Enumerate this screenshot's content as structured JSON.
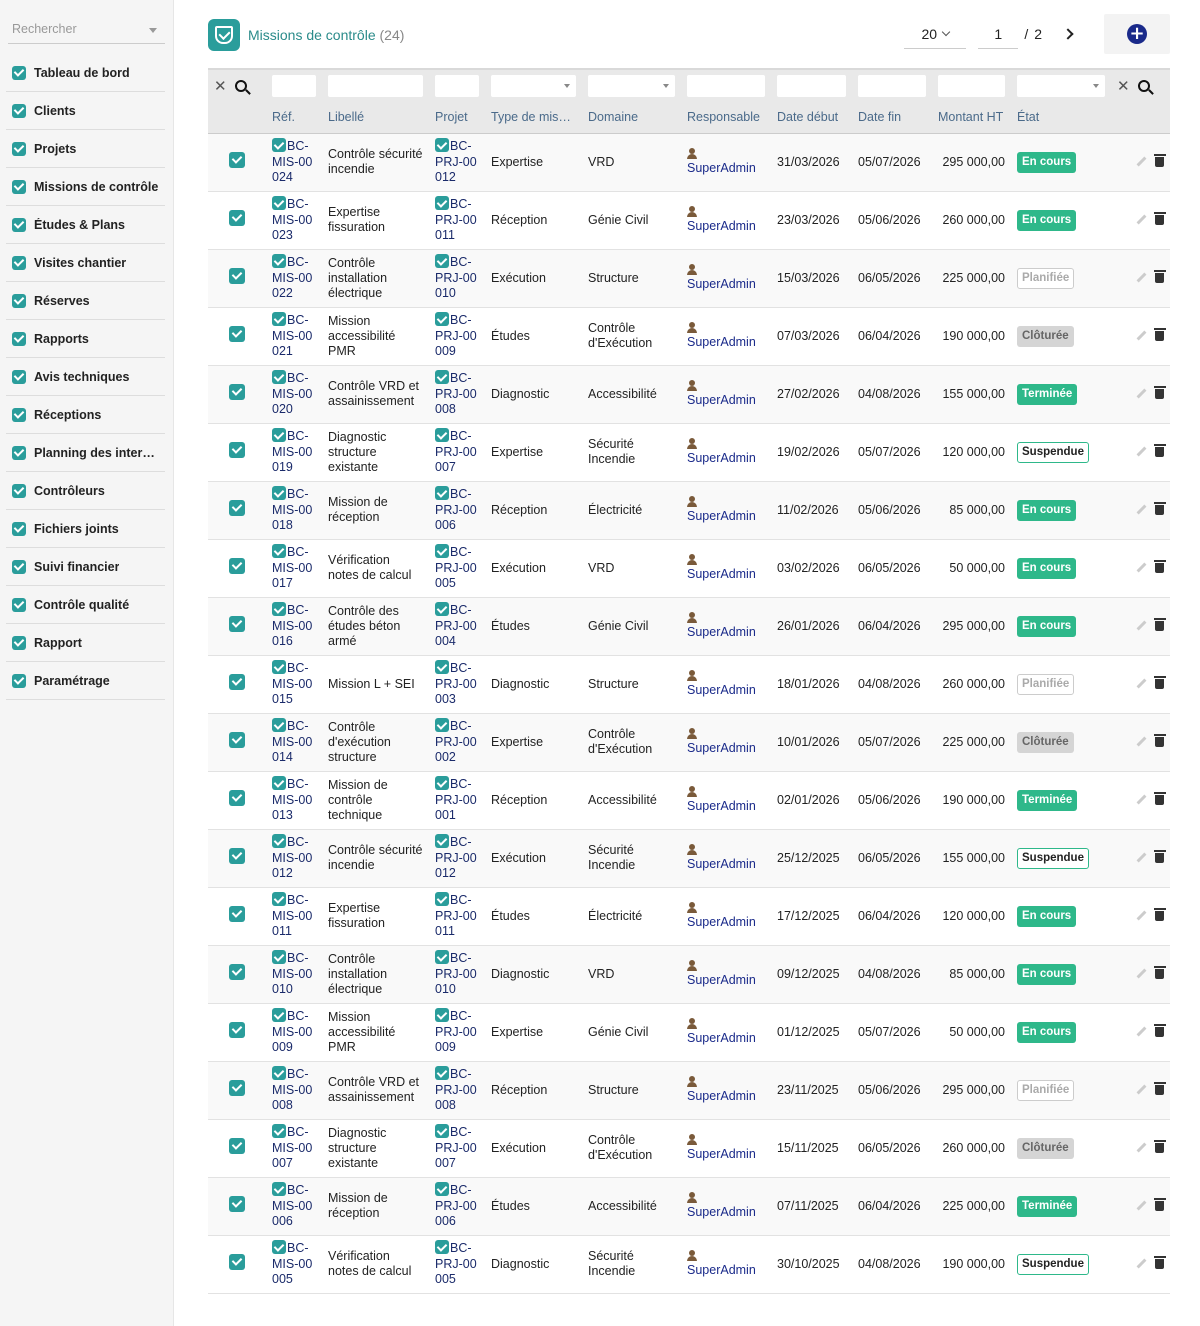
{
  "sidebar": {
    "search_placeholder": "Rechercher",
    "items": [
      {
        "label": "Tableau de bord"
      },
      {
        "label": "Clients"
      },
      {
        "label": "Projets"
      },
      {
        "label": "Missions de contrôle"
      },
      {
        "label": "Études & Plans"
      },
      {
        "label": "Visites chantier"
      },
      {
        "label": "Réserves"
      },
      {
        "label": "Rapports"
      },
      {
        "label": "Avis techniques"
      },
      {
        "label": "Réceptions"
      },
      {
        "label": "Planning des interv…"
      },
      {
        "label": "Contrôleurs"
      },
      {
        "label": "Fichiers joints"
      },
      {
        "label": "Suivi financier"
      },
      {
        "label": "Contrôle qualité"
      },
      {
        "label": "Rapport"
      },
      {
        "label": "Paramétrage"
      }
    ]
  },
  "header": {
    "title": "Missions de contrôle",
    "count": "(24)",
    "page_size": "20",
    "page_current": "1",
    "page_sep": "/",
    "page_total": "2",
    "add_label": "+"
  },
  "columns": [
    "Réf.",
    "Libellé",
    "Projet",
    "Type de mis…",
    "Domaine",
    "Responsable",
    "Date début",
    "Date fin",
    "Montant HT",
    "État"
  ],
  "colors": {
    "accent": "#2a9d9b",
    "status_green": "#2eb88a",
    "link": "#1a2a6a"
  },
  "rows": [
    {
      "ref": "BC-MIS-00024",
      "libelle": "Contrôle sécurité incendie",
      "projet": "BC-PRJ-00012",
      "type": "Expertise",
      "domaine": "VRD",
      "responsable": "SuperAdmin",
      "debut": "31/03/2026",
      "fin": "05/07/2026",
      "montant": "295 000,00",
      "etat": "En cours",
      "etat_style": "encours"
    },
    {
      "ref": "BC-MIS-00023",
      "libelle": "Expertise fissuration",
      "projet": "BC-PRJ-00011",
      "type": "Réception",
      "domaine": "Génie Civil",
      "responsable": "SuperAdmin",
      "debut": "23/03/2026",
      "fin": "05/06/2026",
      "montant": "260 000,00",
      "etat": "En cours",
      "etat_style": "encours"
    },
    {
      "ref": "BC-MIS-00022",
      "libelle": "Contrôle installation électrique",
      "projet": "BC-PRJ-00010",
      "type": "Exécution",
      "domaine": "Structure",
      "responsable": "SuperAdmin",
      "debut": "15/03/2026",
      "fin": "06/05/2026",
      "montant": "225 000,00",
      "etat": "Planifiée",
      "etat_style": "planifiee"
    },
    {
      "ref": "BC-MIS-00021",
      "libelle": "Mission accessibilité PMR",
      "projet": "BC-PRJ-00009",
      "type": "Études",
      "domaine": "Contrôle d'Exécution",
      "responsable": "SuperAdmin",
      "debut": "07/03/2026",
      "fin": "06/04/2026",
      "montant": "190 000,00",
      "etat": "Clôturée",
      "etat_style": "cloturee"
    },
    {
      "ref": "BC-MIS-00020",
      "libelle": "Contrôle VRD et assainissement",
      "projet": "BC-PRJ-00008",
      "type": "Diagnostic",
      "domaine": "Accessibilité",
      "responsable": "SuperAdmin",
      "debut": "27/02/2026",
      "fin": "04/08/2026",
      "montant": "155 000,00",
      "etat": "Terminée",
      "etat_style": "terminee"
    },
    {
      "ref": "BC-MIS-00019",
      "libelle": "Diagnostic structure existante",
      "projet": "BC-PRJ-00007",
      "type": "Expertise",
      "domaine": "Sécurité Incendie",
      "responsable": "SuperAdmin",
      "debut": "19/02/2026",
      "fin": "05/07/2026",
      "montant": "120 000,00",
      "etat": "Suspendue",
      "etat_style": "suspendue"
    },
    {
      "ref": "BC-MIS-00018",
      "libelle": "Mission de réception",
      "projet": "BC-PRJ-00006",
      "type": "Réception",
      "domaine": "Électricité",
      "responsable": "SuperAdmin",
      "debut": "11/02/2026",
      "fin": "05/06/2026",
      "montant": "85 000,00",
      "etat": "En cours",
      "etat_style": "encours"
    },
    {
      "ref": "BC-MIS-00017",
      "libelle": "Vérification notes de calcul",
      "projet": "BC-PRJ-00005",
      "type": "Exécution",
      "domaine": "VRD",
      "responsable": "SuperAdmin",
      "debut": "03/02/2026",
      "fin": "06/05/2026",
      "montant": "50 000,00",
      "etat": "En cours",
      "etat_style": "encours"
    },
    {
      "ref": "BC-MIS-00016",
      "libelle": "Contrôle des études béton armé",
      "projet": "BC-PRJ-00004",
      "type": "Études",
      "domaine": "Génie Civil",
      "responsable": "SuperAdmin",
      "debut": "26/01/2026",
      "fin": "06/04/2026",
      "montant": "295 000,00",
      "etat": "En cours",
      "etat_style": "encours"
    },
    {
      "ref": "BC-MIS-00015",
      "libelle": "Mission L + SEI",
      "projet": "BC-PRJ-00003",
      "type": "Diagnostic",
      "domaine": "Structure",
      "responsable": "SuperAdmin",
      "debut": "18/01/2026",
      "fin": "04/08/2026",
      "montant": "260 000,00",
      "etat": "Planifiée",
      "etat_style": "planifiee"
    },
    {
      "ref": "BC-MIS-00014",
      "libelle": "Contrôle d'exécution structure",
      "projet": "BC-PRJ-00002",
      "type": "Expertise",
      "domaine": "Contrôle d'Exécution",
      "responsable": "SuperAdmin",
      "debut": "10/01/2026",
      "fin": "05/07/2026",
      "montant": "225 000,00",
      "etat": "Clôturée",
      "etat_style": "cloturee"
    },
    {
      "ref": "BC-MIS-00013",
      "libelle": "Mission de contrôle technique",
      "projet": "BC-PRJ-00001",
      "type": "Réception",
      "domaine": "Accessibilité",
      "responsable": "SuperAdmin",
      "debut": "02/01/2026",
      "fin": "05/06/2026",
      "montant": "190 000,00",
      "etat": "Terminée",
      "etat_style": "terminee"
    },
    {
      "ref": "BC-MIS-00012",
      "libelle": "Contrôle sécurité incendie",
      "projet": "BC-PRJ-00012",
      "type": "Exécution",
      "domaine": "Sécurité Incendie",
      "responsable": "SuperAdmin",
      "debut": "25/12/2025",
      "fin": "06/05/2026",
      "montant": "155 000,00",
      "etat": "Suspendue",
      "etat_style": "suspendue"
    },
    {
      "ref": "BC-MIS-00011",
      "libelle": "Expertise fissuration",
      "projet": "BC-PRJ-00011",
      "type": "Études",
      "domaine": "Électricité",
      "responsable": "SuperAdmin",
      "debut": "17/12/2025",
      "fin": "06/04/2026",
      "montant": "120 000,00",
      "etat": "En cours",
      "etat_style": "encours"
    },
    {
      "ref": "BC-MIS-00010",
      "libelle": "Contrôle installation électrique",
      "projet": "BC-PRJ-00010",
      "type": "Diagnostic",
      "domaine": "VRD",
      "responsable": "SuperAdmin",
      "debut": "09/12/2025",
      "fin": "04/08/2026",
      "montant": "85 000,00",
      "etat": "En cours",
      "etat_style": "encours"
    },
    {
      "ref": "BC-MIS-00009",
      "libelle": "Mission accessibilité PMR",
      "projet": "BC-PRJ-00009",
      "type": "Expertise",
      "domaine": "Génie Civil",
      "responsable": "SuperAdmin",
      "debut": "01/12/2025",
      "fin": "05/07/2026",
      "montant": "50 000,00",
      "etat": "En cours",
      "etat_style": "encours"
    },
    {
      "ref": "BC-MIS-00008",
      "libelle": "Contrôle VRD et assainissement",
      "projet": "BC-PRJ-00008",
      "type": "Réception",
      "domaine": "Structure",
      "responsable": "SuperAdmin",
      "debut": "23/11/2025",
      "fin": "05/06/2026",
      "montant": "295 000,00",
      "etat": "Planifiée",
      "etat_style": "planifiee"
    },
    {
      "ref": "BC-MIS-00007",
      "libelle": "Diagnostic structure existante",
      "projet": "BC-PRJ-00007",
      "type": "Exécution",
      "domaine": "Contrôle d'Exécution",
      "responsable": "SuperAdmin",
      "debut": "15/11/2025",
      "fin": "06/05/2026",
      "montant": "260 000,00",
      "etat": "Clôturée",
      "etat_style": "cloturee"
    },
    {
      "ref": "BC-MIS-00006",
      "libelle": "Mission de réception",
      "projet": "BC-PRJ-00006",
      "type": "Études",
      "domaine": "Accessibilité",
      "responsable": "SuperAdmin",
      "debut": "07/11/2025",
      "fin": "06/04/2026",
      "montant": "225 000,00",
      "etat": "Terminée",
      "etat_style": "terminee"
    },
    {
      "ref": "BC-MIS-00005",
      "libelle": "Vérification notes de calcul",
      "projet": "BC-PRJ-00005",
      "type": "Diagnostic",
      "domaine": "Sécurité Incendie",
      "responsable": "SuperAdmin",
      "debut": "30/10/2025",
      "fin": "04/08/2026",
      "montant": "190 000,00",
      "etat": "Suspendue",
      "etat_style": "suspendue"
    }
  ]
}
